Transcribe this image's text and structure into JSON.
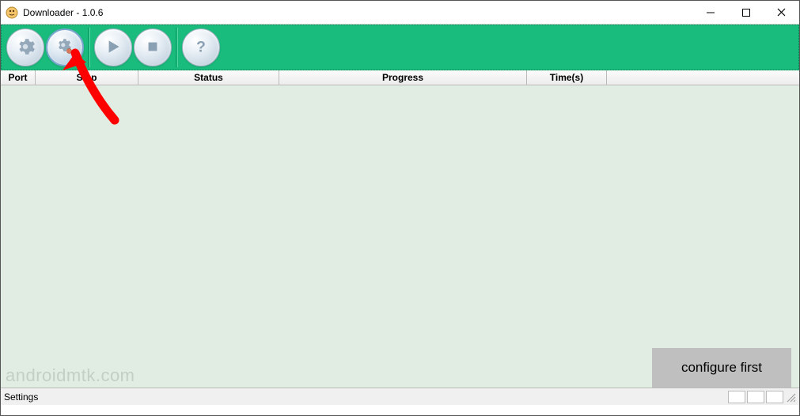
{
  "window": {
    "title": "Downloader - 1.0.6"
  },
  "toolbar": {
    "buttons": [
      {
        "name": "settings",
        "selected": false
      },
      {
        "name": "configure",
        "selected": true
      },
      {
        "name": "start",
        "selected": false
      },
      {
        "name": "stop",
        "selected": false
      },
      {
        "name": "help",
        "selected": false
      }
    ]
  },
  "table": {
    "headers": {
      "port": "Port",
      "step": "Step",
      "status": "Status",
      "progress": "Progress",
      "time": "Time(s)"
    },
    "rows": []
  },
  "annotation": {
    "callout": "configure first"
  },
  "watermark": "androidmtk.com",
  "statusbar": {
    "text": "Settings"
  }
}
